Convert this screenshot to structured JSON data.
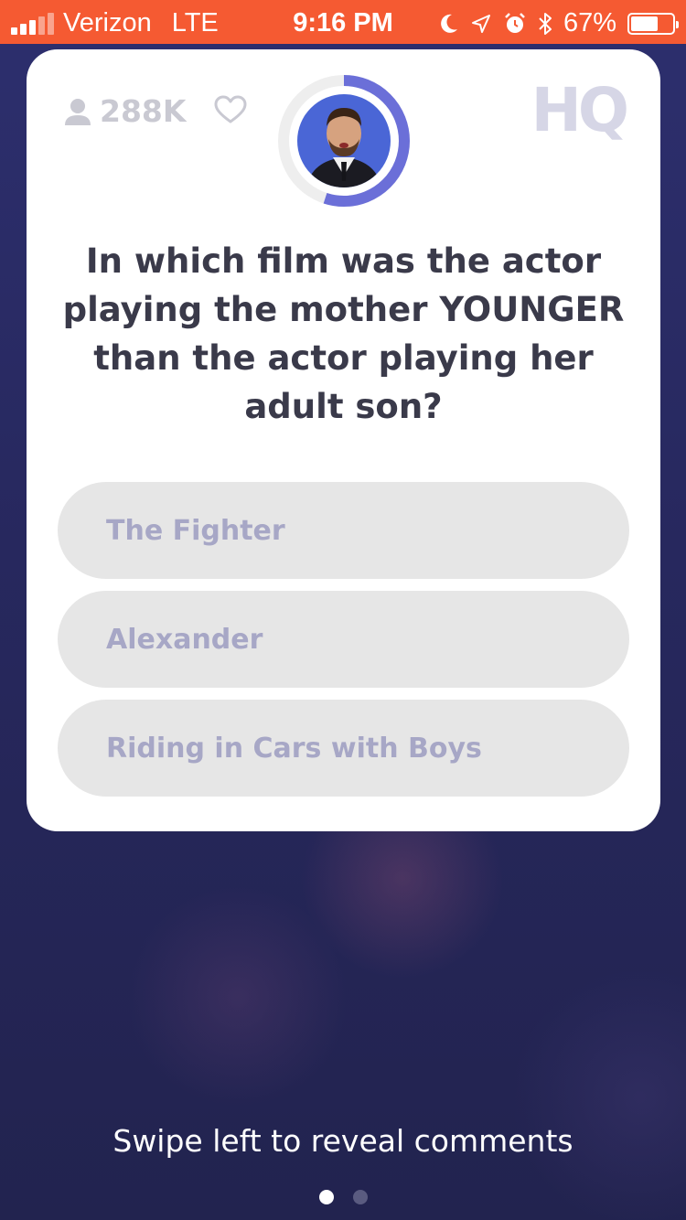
{
  "status_bar": {
    "carrier": "Verizon",
    "network": "LTE",
    "time": "9:16 PM",
    "battery": "67%",
    "battery_level": 0.67,
    "bg_color": "#f55a32",
    "icons": [
      "signal-icon",
      "moon-icon",
      "location-icon",
      "alarm-icon",
      "bluetooth-icon",
      "battery-icon"
    ]
  },
  "game": {
    "viewer_count": "288K",
    "logo": "HQ",
    "timer_progress": 0.55,
    "accent_color": "#6b6fd8",
    "question": "In which film was the actor playing the mother YOUNGER than the actor playing her adult son?",
    "answers": [
      {
        "label": "The Fighter"
      },
      {
        "label": "Alexander"
      },
      {
        "label": "Riding in Cars with Boys"
      }
    ]
  },
  "footer": {
    "hint": "Swipe left to reveal comments",
    "page_count": 2,
    "active_page": 1
  }
}
